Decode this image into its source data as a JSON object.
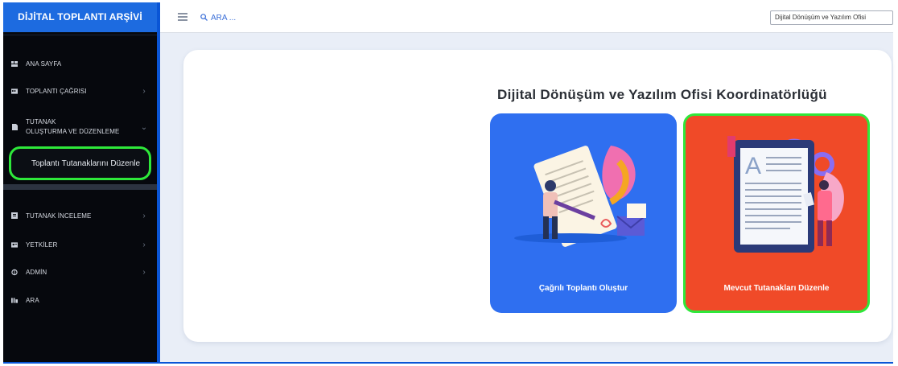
{
  "app": {
    "title": "DİJİTAL TOPLANTI ARŞİVİ"
  },
  "sidebar": {
    "items": [
      {
        "label": "ANA SAYFA",
        "icon": "dashboard-icon"
      },
      {
        "label": "TOPLANTI ÇAĞRISI",
        "icon": "calendar-icon",
        "chevron": "›"
      },
      {
        "label_line1": "TUTANAK",
        "label_line2": "OLUŞTURMA VE DÜZENLEME",
        "icon": "document-icon",
        "chevron": "⌄"
      },
      {
        "label": "TUTANAK İNCELEME",
        "icon": "review-icon",
        "chevron": "›"
      },
      {
        "label": "YETKİLER",
        "icon": "permissions-icon",
        "chevron": "›"
      },
      {
        "label": "ADMİN",
        "icon": "admin-icon",
        "chevron": "›"
      },
      {
        "label": "ARA",
        "icon": "search-icon"
      }
    ],
    "sub_item": "Toplantı Tutanaklarını Düzenle"
  },
  "topbar": {
    "search_placeholder": "ARA ...",
    "unit_select": "Dijital Dönüşüm ve Yazılım Ofisi"
  },
  "main": {
    "org_title": "Dijital Dönüşüm ve Yazılım Ofisi Koordinatörlüğü",
    "cards": [
      {
        "label": "Çağrılı Toplantı Oluştur",
        "color": "#2f6ff0"
      },
      {
        "label": "Mevcut Tutanakları Düzenle",
        "color": "#f04a28"
      }
    ]
  },
  "colors": {
    "highlight": "#2ee83a",
    "brand": "#1d6be0"
  }
}
